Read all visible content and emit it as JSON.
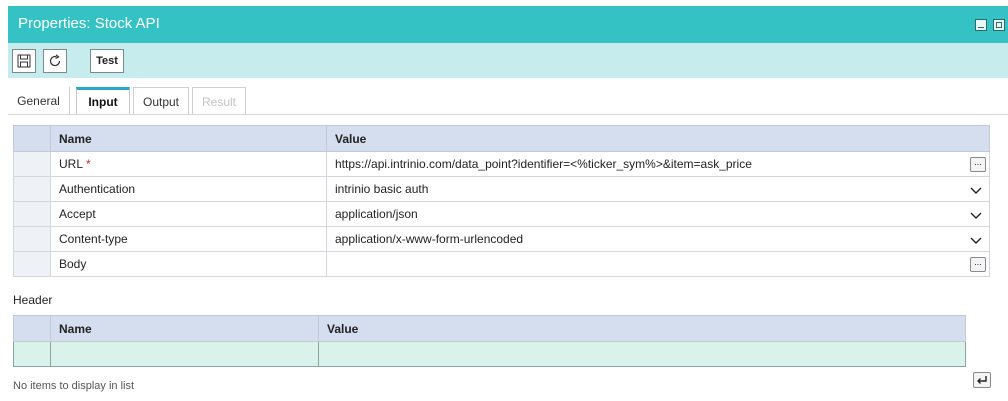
{
  "window": {
    "title": "Properties: Stock API"
  },
  "toolbar": {
    "save_icon": "save-icon",
    "refresh_icon": "refresh-icon",
    "test_label": "Test"
  },
  "tabs": [
    {
      "label": "General",
      "state": "normal"
    },
    {
      "label": "Input",
      "state": "active"
    },
    {
      "label": "Output",
      "state": "normal"
    },
    {
      "label": "Result",
      "state": "disabled"
    }
  ],
  "properties": {
    "columns": [
      "Name",
      "Value"
    ],
    "rows": [
      {
        "name": "URL",
        "required": "*",
        "value": "https://api.intrinio.com/data_point?identifier=<%ticker_sym%>&item=ask_price",
        "control": "ellipsis"
      },
      {
        "name": "Authentication",
        "value": "intrinio basic auth",
        "control": "dropdown"
      },
      {
        "name": "Accept",
        "value": "application/json",
        "control": "dropdown"
      },
      {
        "name": "Content-type",
        "value": "application/x-www-form-urlencoded",
        "control": "dropdown"
      },
      {
        "name": "Body",
        "value": "",
        "control": "ellipsis"
      }
    ],
    "ellipsis_label": "..."
  },
  "header_section": {
    "label": "Header",
    "columns": [
      "Name",
      "Value"
    ],
    "empty_message": "No items to display in list"
  },
  "colors": {
    "titlebar": "#35c2c5",
    "toolbar": "#c6ecee",
    "active_tab": "#29a9c7",
    "grid_header": "#d5deef",
    "new_row": "#d9f2ea"
  }
}
